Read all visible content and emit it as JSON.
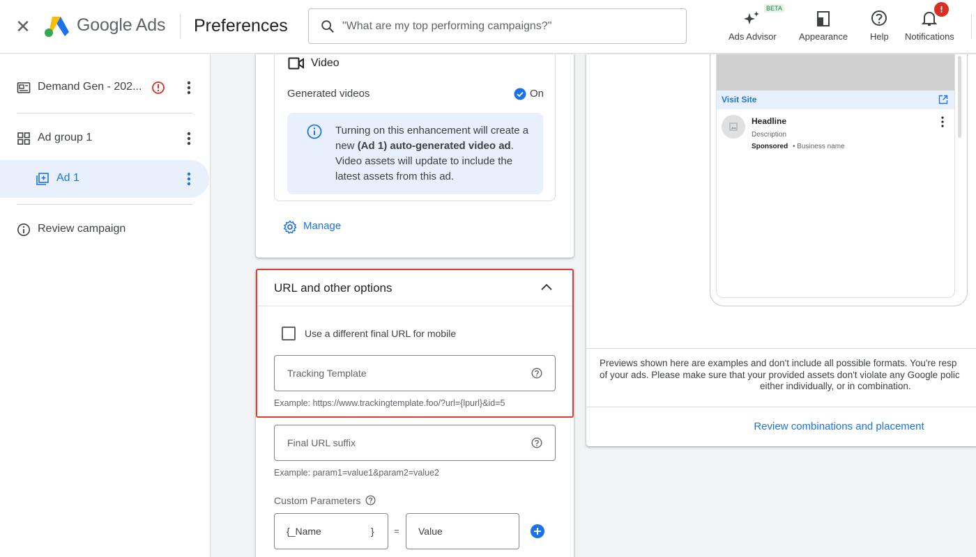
{
  "header": {
    "brand": "Google Ads",
    "page_title": "Preferences",
    "search_placeholder": "\"What are my top performing campaigns?\"",
    "beta_badge": "BETA",
    "notification_badge": "!",
    "tools": [
      {
        "label": "Ads Advisor",
        "icon": "sparkle-icon"
      },
      {
        "label": "Appearance",
        "icon": "appearance-icon"
      },
      {
        "label": "Help",
        "icon": "help-icon"
      },
      {
        "label": "Notifications",
        "icon": "bell-icon"
      }
    ]
  },
  "sidebar": {
    "items": [
      {
        "label": "Demand Gen - 202...",
        "icon": "campaign-icon",
        "status": "error-icon"
      },
      {
        "label": "Ad group 1",
        "icon": "grid-icon"
      },
      {
        "label": "Ad 1",
        "icon": "ad-icon",
        "active": true
      },
      {
        "label": "Review campaign",
        "icon": "info-icon"
      }
    ]
  },
  "video_card": {
    "title": "Video",
    "generated_label": "Generated videos",
    "generated_state": "On",
    "info_pre": "Turning on this enhancement will create a new ",
    "info_bold": "(Ad 1) auto-generated video ad",
    "info_post": ". Video assets will update to include the latest assets from this ad.",
    "manage_label": "Manage"
  },
  "url_options": {
    "title": "URL and other options",
    "mobile_checkbox_label": "Use a different final URL for mobile",
    "mobile_checked": false,
    "tracking_template_placeholder": "Tracking Template",
    "tracking_template_hint": "Example: https://www.trackingtemplate.foo/?url={lpurl}&id=5",
    "final_url_suffix_placeholder": "Final URL suffix",
    "final_url_suffix_hint": "Example: param1=value1&param2=value2",
    "custom_parameters_label": "Custom Parameters",
    "param_name_placeholder": "{_Name",
    "param_name_suffix": "}",
    "equals": "=",
    "param_value_placeholder": "Value"
  },
  "preview": {
    "visit_site": "Visit Site",
    "headline": "Headline",
    "description": "Description",
    "sponsored": "Sponsored",
    "separator": " • ",
    "business_name": "Business name",
    "disclaimer_line1": "Previews shown here are examples and don't include all possible formats. You're resp",
    "disclaimer_line2": "of your ads. Please make sure that your provided assets don't violate any Google polic",
    "disclaimer_line3": "either individually, or in combination.",
    "review_link": "Review combinations and placement"
  },
  "colors": {
    "accent": "#1a73e8",
    "highlight_border": "#e53935",
    "error": "#d93025",
    "active_nav_bg": "#e8f0fe"
  }
}
